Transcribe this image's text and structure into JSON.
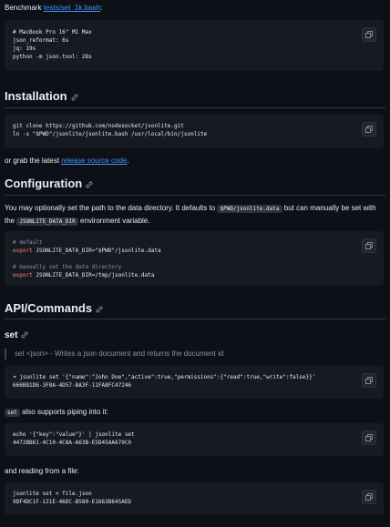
{
  "benchmark": {
    "prefix": "Benchmark ",
    "link": "tests/set_1k.bash",
    "suffix": ":",
    "code": "# MacBook Pro 16\" M1 Max\njson_reformat: 6s\njq: 19s\npython -m json.tool: 28s"
  },
  "installation": {
    "heading": "Installation",
    "code": "git clone https://github.com/nodesocket/jsonlite.git\nln -s \"$PWD\"/jsonlite/jsonlite.bash /usr/local/bin/jsonlite",
    "or_text": "or grab the latest ",
    "release_link": "release source code",
    "period": "."
  },
  "configuration": {
    "heading": "Configuration",
    "text_1": "You may optionally set the path to the data directory. It defaults to ",
    "code_1": "$PWD/jsonlite.data",
    "text_2": " but can manually be set with",
    "text_3": "the ",
    "code_2": "JSONLITE_DATA_DIR",
    "text_4": " environment variable.",
    "code_lines": {
      "c1": "# default",
      "kw1": "export",
      "l1": " JSONLITE_DATA_DIR=\"$PWD\"/jsonlite.data",
      "c2": "# manually set the data directory",
      "kw2": "export",
      "l2": " JSONLITE_DATA_DIR=/tmp/jsonlite.data"
    }
  },
  "api": {
    "heading": "API/Commands",
    "set_heading": "set",
    "quote": "set <json> - Writes a json document and returns the document id",
    "set_code": "➜ jsonlite set '{\"name\":\"John Doe\",\"active\":true,\"permissions\":{\"read\":true,\"write\":false}}'\n666B81D6-3F8A-4D57-BA3F-11FA8FC47246",
    "pipe_code_inline": "set",
    "pipe_text": " also supports piping into it:",
    "pipe_code": "echo '{\"key\":\"value\"}' | jsonlite set\n4472BB61-4C10-4C8A-A63B-E5D45AA679C0",
    "file_text": "and reading from a file:",
    "file_code": "jsonlite set < file.json\n9DF4DC1F-121E-46DC-B580-E1663B645AED"
  },
  "icons": {
    "copy": "copy-icon",
    "link": "link-icon"
  }
}
